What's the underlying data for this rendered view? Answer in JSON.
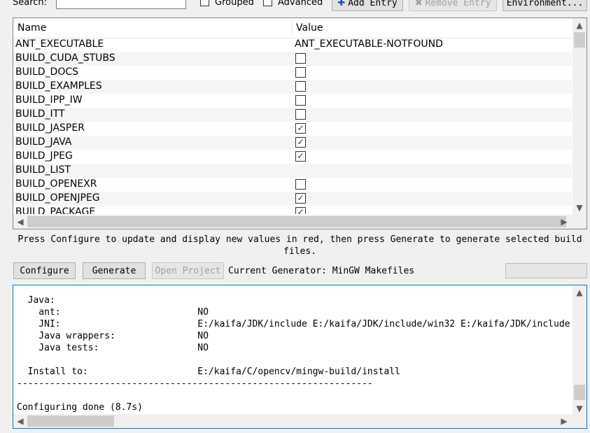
{
  "toolbar": {
    "search_label": "Search:",
    "search_value": "",
    "grouped_label": "Grouped",
    "grouped_checked": false,
    "advanced_label": "Advanced",
    "advanced_checked": false,
    "add_entry_label": "Add Entry",
    "remove_entry_label": "Remove Entry",
    "environment_label": "Environment..."
  },
  "table": {
    "columns": [
      "Name",
      "Value"
    ],
    "rows": [
      {
        "name": "ANT_EXECUTABLE",
        "type": "text",
        "value": "ANT_EXECUTABLE-NOTFOUND"
      },
      {
        "name": "BUILD_CUDA_STUBS",
        "type": "bool",
        "value": false
      },
      {
        "name": "BUILD_DOCS",
        "type": "bool",
        "value": false
      },
      {
        "name": "BUILD_EXAMPLES",
        "type": "bool",
        "value": false
      },
      {
        "name": "BUILD_IPP_IW",
        "type": "bool",
        "value": false
      },
      {
        "name": "BUILD_ITT",
        "type": "bool",
        "value": false
      },
      {
        "name": "BUILD_JASPER",
        "type": "bool",
        "value": true
      },
      {
        "name": "BUILD_JAVA",
        "type": "bool",
        "value": true
      },
      {
        "name": "BUILD_JPEG",
        "type": "bool",
        "value": true
      },
      {
        "name": "BUILD_LIST",
        "type": "text",
        "value": ""
      },
      {
        "name": "BUILD_OPENEXR",
        "type": "bool",
        "value": false
      },
      {
        "name": "BUILD_OPENJPEG",
        "type": "bool",
        "value": true
      },
      {
        "name": "BUILD_PACKAGE",
        "type": "bool",
        "value": true
      }
    ]
  },
  "message": "Press Configure to update and display new values in red, then press Generate to generate selected build files.",
  "actions": {
    "configure_label": "Configure",
    "generate_label": "Generate",
    "open_project_label": "Open Project",
    "current_generator": "Current Generator: MinGW Makefiles"
  },
  "output": {
    "lines": [
      "  Java:",
      "    ant:                         NO",
      "    JNI:                         E:/kaifa/JDK/include E:/kaifa/JDK/include/win32 E:/kaifa/JDK/include",
      "    Java wrappers:               NO",
      "    Java tests:                  NO",
      "",
      "  Install to:                    E:/kaifa/C/opencv/mingw-build/install",
      "-----------------------------------------------------------------",
      "",
      "Configuring done (8.7s)"
    ]
  },
  "icons": {
    "scroll_up": "▲",
    "scroll_down": "▼",
    "scroll_left": "◀",
    "scroll_right": "▶",
    "check": "✓",
    "plus": "✚",
    "remove": "✖"
  }
}
